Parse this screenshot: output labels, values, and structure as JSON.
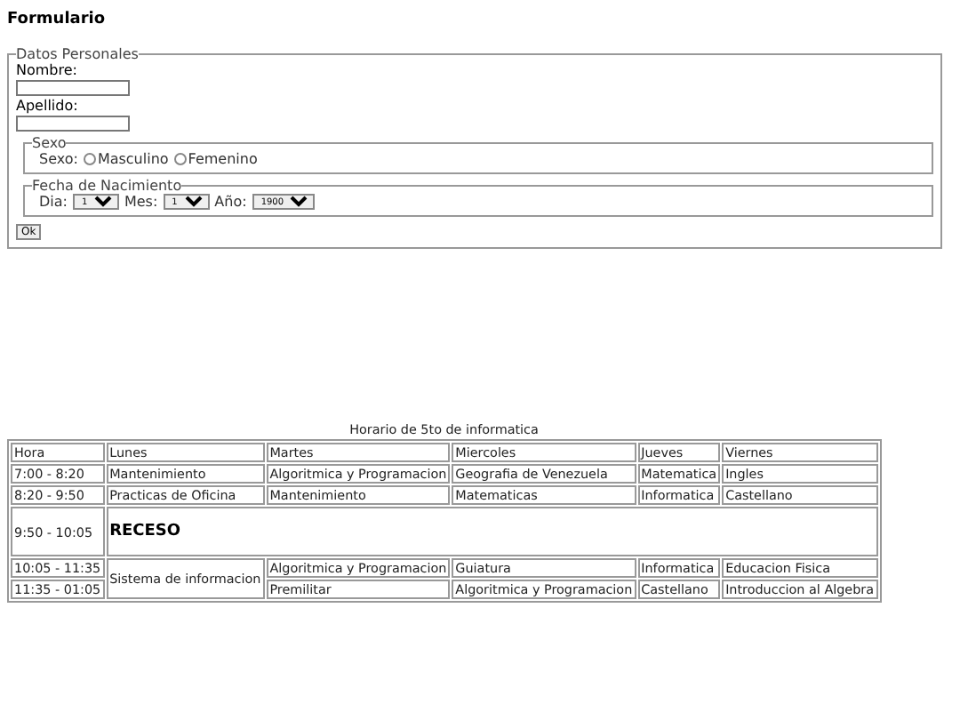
{
  "heading": "Formulario",
  "form": {
    "legend": "Datos Personales",
    "fields": [
      {
        "label": "Nombre:"
      },
      {
        "label": "Apellido:"
      }
    ],
    "sexo": {
      "legend": "Sexo",
      "label": "Sexo:",
      "options": [
        {
          "label": "Masculino",
          "selected": false
        },
        {
          "label": "Femenino",
          "selected": false
        }
      ]
    },
    "fecha": {
      "legend": "Fecha de Nacimiento",
      "selects": [
        {
          "label": "Dia:",
          "value": "1"
        },
        {
          "label": "Mes:",
          "value": "1"
        },
        {
          "label": "Año:",
          "value": "1900"
        }
      ]
    },
    "submit": "Ok"
  },
  "table": {
    "caption": "Horario de 5to de informatica",
    "columns": [
      "Hora",
      "Lunes",
      "Martes",
      "Miercoles",
      "Jueves",
      "Viernes"
    ],
    "rows": [
      {
        "kind": "classes",
        "hora": "7:00 - 8:20",
        "cells": [
          {
            "text": "Mantenimiento",
            "spans_next_row": false
          },
          {
            "text": "Algoritmica y Programacion",
            "spans_next_row": false
          },
          {
            "text": "Geografia de Venezuela",
            "spans_next_row": false
          },
          {
            "text": "Matematica",
            "spans_next_row": false
          },
          {
            "text": "Ingles",
            "spans_next_row": false
          }
        ]
      },
      {
        "kind": "classes",
        "hora": "8:20 - 9:50",
        "cells": [
          {
            "text": "Practicas de Oficina",
            "spans_next_row": false
          },
          {
            "text": "Mantenimiento",
            "spans_next_row": false
          },
          {
            "text": "Matematicas",
            "spans_next_row": false
          },
          {
            "text": "Informatica",
            "spans_next_row": false
          },
          {
            "text": "Castellano",
            "spans_next_row": false
          }
        ]
      },
      {
        "kind": "break",
        "hora": "9:50 - 10:05",
        "text": "RECESO"
      },
      {
        "kind": "classes",
        "hora": "10:05 - 11:35",
        "cells": [
          {
            "text": "Sistema de informacion",
            "spans_next_row": true
          },
          {
            "text": "Algoritmica y Programacion",
            "spans_next_row": false
          },
          {
            "text": "Guiatura",
            "spans_next_row": false
          },
          {
            "text": "Informatica",
            "spans_next_row": false
          },
          {
            "text": "Educacion Fisica",
            "spans_next_row": false
          }
        ]
      },
      {
        "kind": "classes",
        "hora": "11:35 - 01:05",
        "cells": [
          {
            "text": "Premilitar",
            "spans_next_row": false
          },
          {
            "text": "Algoritmica y Programacion",
            "spans_next_row": false
          },
          {
            "text": "Castellano",
            "spans_next_row": false
          },
          {
            "text": "Introduccion al Algebra",
            "spans_next_row": false
          }
        ]
      }
    ]
  }
}
